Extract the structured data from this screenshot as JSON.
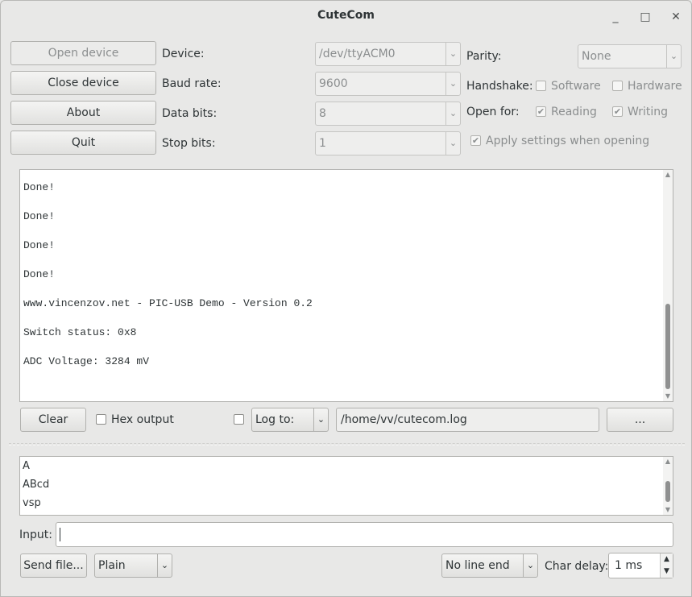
{
  "window": {
    "title": "CuteCom",
    "minimize_glyph": "_",
    "maximize_glyph": "□",
    "close_glyph": "✕"
  },
  "buttons": {
    "open_device": "Open device",
    "close_device": "Close device",
    "about": "About",
    "quit": "Quit",
    "clear": "Clear",
    "browse": "...",
    "send_file": "Send file..."
  },
  "settings": {
    "device_label": "Device:",
    "device_value": "/dev/ttyACM0",
    "baud_label": "Baud rate:",
    "baud_value": "9600",
    "databits_label": "Data bits:",
    "databits_value": "8",
    "stopbits_label": "Stop bits:",
    "stopbits_value": "1",
    "parity_label": "Parity:",
    "parity_value": "None",
    "handshake_label": "Handshake:",
    "handshake_software": "Software",
    "handshake_hardware": "Hardware",
    "open_for_label": "Open for:",
    "open_reading": "Reading",
    "open_writing": "Writing",
    "apply_settings": "Apply settings when opening"
  },
  "output": {
    "lines": [
      "Done!",
      "Done!",
      "Done!",
      "Done!",
      "www.vincenzov.net - PIC-USB Demo - Version 0.2",
      "Switch status: 0x8",
      "ADC Voltage: 3284 mV"
    ]
  },
  "output_controls": {
    "hex_output": "Hex output",
    "log_mode": "Log to:",
    "log_path": "/home/vv/cutecom.log"
  },
  "history": {
    "lines": [
      "A",
      "ABcd",
      "vsp"
    ]
  },
  "input": {
    "label": "Input:",
    "value": ""
  },
  "bottom": {
    "send_mode": "Plain",
    "line_end": "No line end",
    "char_delay_label": "Char delay:",
    "char_delay_value": "1 ms"
  },
  "icons": {
    "dropdown": "⌄",
    "check": "✔",
    "scroll_up": "▲",
    "scroll_down": "▼"
  }
}
